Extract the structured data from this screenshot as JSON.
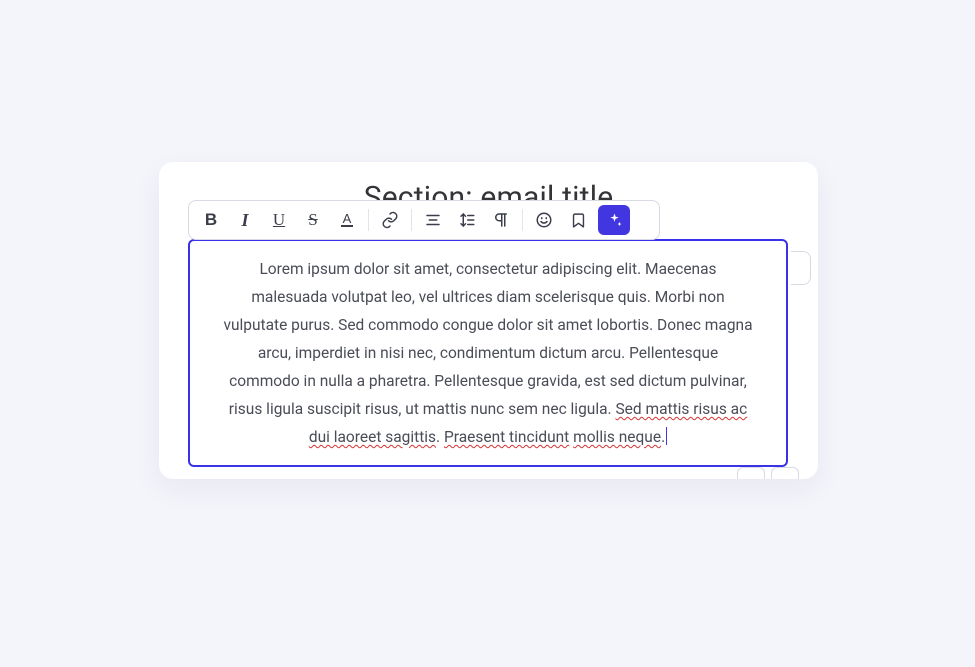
{
  "section_title": "Section: email title",
  "toolbar": {
    "bold": "B",
    "italic": "I",
    "underline": "U",
    "strike": "S",
    "color": "A"
  },
  "editor": {
    "text_plain": "Lorem ipsum dolor sit amet, consectetur adipiscing elit. Maecenas malesuada volutpat leo, vel ultrices diam scelerisque quis. Morbi non vulputate purus. Sed commodo congue dolor sit amet lobortis. Donec magna arcu, imperdiet in nisi nec, condimentum dictum arcu. Pellentesque commodo in nulla a pharetra. Pellentesque gravida, est sed dictum pulvinar, risus ligula suscipit risus, ut mattis nunc sem nec ligula. ",
    "spell1": "Sed mattis risus ac dui laoreet sagittis",
    "mid": ". ",
    "spell2_a": "Praesent tincidunt",
    "spell2_b": "mollis neque",
    "tail_period": "."
  }
}
